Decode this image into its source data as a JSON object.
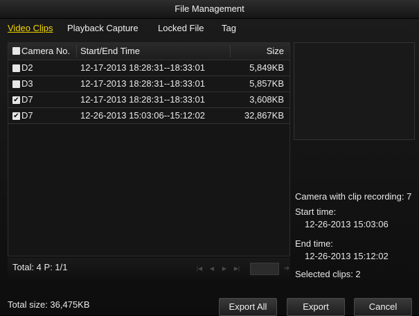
{
  "window": {
    "title": "File Management"
  },
  "tabs": [
    {
      "label": "Video Clips",
      "active": true
    },
    {
      "label": "Playback Capture",
      "active": false
    },
    {
      "label": "Locked File",
      "active": false
    },
    {
      "label": "Tag",
      "active": false
    }
  ],
  "table": {
    "headers": {
      "camera": "Camera No.",
      "time": "Start/End Time",
      "size": "Size"
    },
    "rows": [
      {
        "checked": false,
        "camera": "D2",
        "time": "12-17-2013 18:28:31--18:33:01",
        "size": "5,849KB"
      },
      {
        "checked": false,
        "camera": "D3",
        "time": "12-17-2013 18:28:31--18:33:01",
        "size": "5,857KB"
      },
      {
        "checked": true,
        "camera": "D7",
        "time": "12-17-2013 18:28:31--18:33:01",
        "size": "3,608KB"
      },
      {
        "checked": true,
        "camera": "D7",
        "time": "12-26-2013 15:03:06--15:12:02",
        "size": "32,867KB"
      }
    ]
  },
  "footer": {
    "total": "Total: 4  P: 1/1"
  },
  "details": {
    "camera": "Camera with clip recording: 7",
    "start_label": "Start time:",
    "start_value": "12-26-2013 15:03:06",
    "end_label": "End time:",
    "end_value": "12-26-2013 15:12:02",
    "selected": "Selected clips: 2"
  },
  "bottom": {
    "total_size": "Total size: 36,475KB",
    "export_all": "Export All",
    "export": "Export",
    "cancel": "Cancel"
  },
  "colors": {
    "active_tab": "#f5d800",
    "background": "#111111"
  }
}
